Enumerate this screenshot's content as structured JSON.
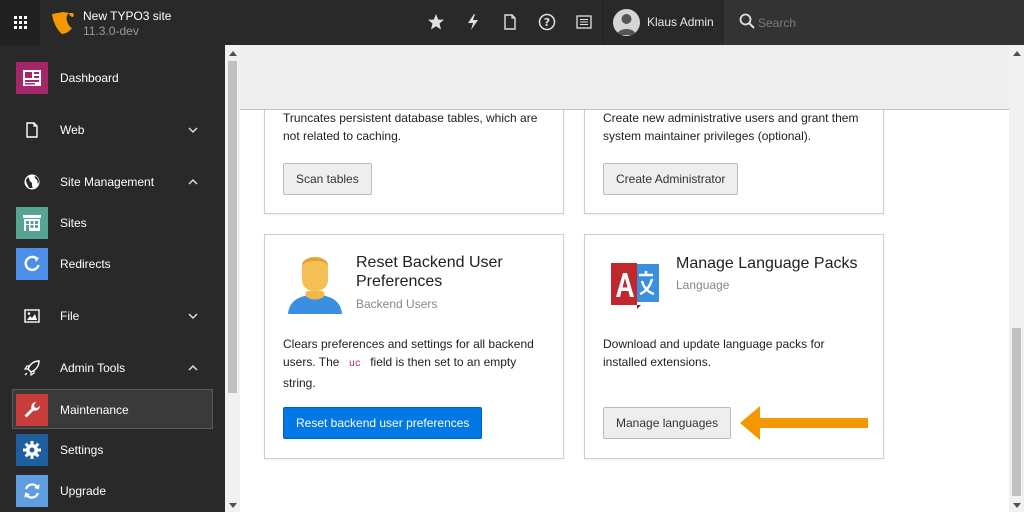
{
  "topbar": {
    "site_name": "New TYPO3 site",
    "site_version": "11.3.0-dev",
    "user_name": "Klaus Admin",
    "search_placeholder": "Search",
    "icons": [
      "apps-grid-icon",
      "typo3-logo-icon",
      "star-icon",
      "bolt-icon",
      "file-icon",
      "help-icon",
      "system-info-icon",
      "user-avatar-icon",
      "search-icon"
    ]
  },
  "sidebar": {
    "items": [
      {
        "label": "Dashboard",
        "icon": "dashboard-icon",
        "color": "#a4276a"
      },
      {
        "label": "Web",
        "icon": "page-icon",
        "expanded": false
      },
      {
        "label": "Site Management",
        "icon": "globe-icon",
        "expanded": true
      },
      {
        "label": "Sites",
        "icon": "sites-icon",
        "color": "#56a494"
      },
      {
        "label": "Redirects",
        "icon": "redirects-icon",
        "color": "#4d8fe6"
      },
      {
        "label": "File",
        "icon": "image-icon",
        "expanded": false
      },
      {
        "label": "Admin Tools",
        "icon": "rocket-icon",
        "expanded": true
      },
      {
        "label": "Maintenance",
        "icon": "wrench-icon",
        "color": "#c83c3c",
        "active": true
      },
      {
        "label": "Settings",
        "icon": "gear-icon",
        "color": "#1e5fa0"
      },
      {
        "label": "Upgrade",
        "icon": "upgrade-icon",
        "color": "#5e9de0"
      }
    ]
  },
  "cards": {
    "truncate": {
      "desc_line1": "Truncates persistent database tables, which are",
      "desc_line2": "not related to caching.",
      "button": "Scan tables"
    },
    "admin": {
      "desc_line1": "Create new administrative users and grant them",
      "desc_line2": "system maintainer privileges (optional).",
      "button": "Create Administrator"
    },
    "reset": {
      "title_line1": "Reset Backend User",
      "title_line2": "Preferences",
      "subtitle": "Backend Users",
      "desc_line1": "Clears preferences and settings for all backend",
      "desc_line2a": "users. The",
      "desc_code": "uc",
      "desc_line2b": "field is then set to an empty",
      "desc_line3": "string.",
      "button": "Reset backend user preferences"
    },
    "language": {
      "title": "Manage Language Packs",
      "subtitle": "Language",
      "desc_line1": "Download and update language packs for",
      "desc_line2": "installed extensions.",
      "button": "Manage languages"
    }
  },
  "colors": {
    "topbar_bg": "#292929",
    "sidebar_bg": "#292929",
    "primary_button": "#0078e6",
    "annotation_arrow": "#f49700",
    "typo3_orange": "#f49700"
  }
}
